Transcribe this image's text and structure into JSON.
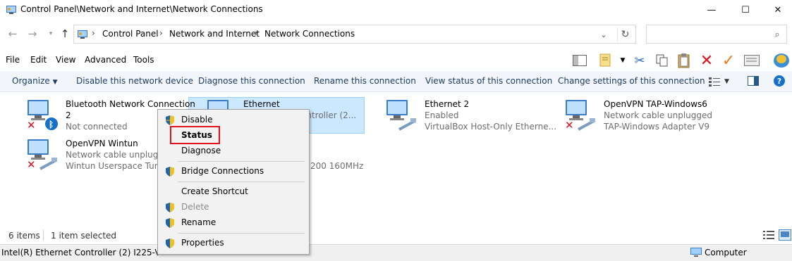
{
  "window": {
    "title": "Control Panel\\Network and Internet\\Network Connections",
    "minimize_glyph": "—",
    "maximize_glyph": "☐",
    "close_glyph": "✕"
  },
  "address": {
    "crumbs": [
      "Control Panel",
      "Network and Internet",
      "Network Connections"
    ],
    "separator": "›",
    "search_placeholder": ""
  },
  "menu": {
    "items": [
      "File",
      "Edit",
      "View",
      "Advanced",
      "Tools"
    ]
  },
  "toolbar_icons": [
    "preview-pane-icon",
    "folder-note-icon",
    "dropdown-arrow-icon",
    "cut-icon",
    "copy-icon",
    "paste-icon",
    "delete-icon",
    "checkmark-icon",
    "properties-icon",
    "shell-logo-icon"
  ],
  "commands": {
    "organize": "Organize",
    "disable": "Disable this network device",
    "diagnose": "Diagnose this connection",
    "rename": "Rename this connection",
    "view_status": "View status of this connection",
    "change_settings": "Change settings of this connection"
  },
  "connections": [
    {
      "name": "Bluetooth Network Connection",
      "name2": "2",
      "status": "Not connected",
      "adapter": "",
      "badge": "bluetooth",
      "disabled": true
    },
    {
      "name": "Ethernet",
      "status": "",
      "adapter": "ontroller (2...",
      "badge": "",
      "disabled": false
    },
    {
      "name": "Ethernet 2",
      "status": "Enabled",
      "adapter": "VirtualBox Host-Only Etherne...",
      "badge": "cable",
      "disabled": false
    },
    {
      "name": "OpenVPN TAP-Windows6",
      "status": "Network cable unplugged",
      "adapter": "TAP-Windows Adapter V9",
      "badge": "cable",
      "disabled": true
    },
    {
      "name": "OpenVPN Wintun",
      "status": "Network cable unplugge",
      "adapter": "Wintun Userspace Tunne",
      "badge": "cable",
      "disabled": true
    },
    {
      "name": "",
      "status": "",
      "adapter": "200 160MHz",
      "badge": "",
      "disabled": false
    }
  ],
  "context_menu": {
    "disable": "Disable",
    "status": "Status",
    "diagnose": "Diagnose",
    "bridge": "Bridge Connections",
    "shortcut": "Create Shortcut",
    "delete": "Delete",
    "rename": "Rename",
    "properties": "Properties"
  },
  "statusbar": {
    "count": "6 items",
    "selected": "1 item selected"
  },
  "infobar": {
    "selected_device": "Intel(R) Ethernet Controller (2) I225-V",
    "location": "Computer"
  },
  "colors": {
    "command_text": "#1c3d66",
    "selection_bg": "#cce8ff",
    "highlight_border": "#e0121b",
    "error_x": "#e0121b"
  }
}
